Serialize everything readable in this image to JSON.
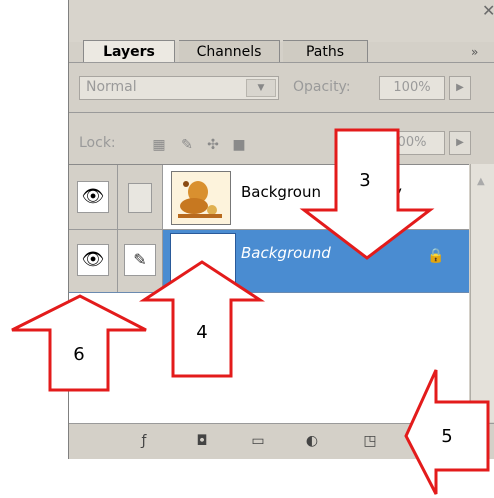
{
  "panel": {
    "close_glyph": "✕",
    "tabs": [
      {
        "label": "Layers",
        "active": true
      },
      {
        "label": "Channels",
        "active": false
      },
      {
        "label": "Paths",
        "active": false
      }
    ],
    "menu_glyph": "»",
    "blend_mode": "Normal",
    "opacity_label": "Opacity:",
    "opacity_value": "100%",
    "lock_label": "Lock:",
    "fill_value": "00%",
    "layers": [
      {
        "name": "Backgroun",
        "name_tail": "y",
        "selected": false,
        "visible": true,
        "locked": false
      },
      {
        "name": "Background",
        "selected": true,
        "visible": true,
        "locked": true
      }
    ],
    "bottom_icons": [
      "layer-style-icon",
      "mask-icon",
      "folder-icon",
      "adjustment-icon",
      "new-layer-icon"
    ]
  },
  "annotations": {
    "labels": [
      "3",
      "4",
      "5",
      "6"
    ],
    "arrow_color": "#e31b1b"
  },
  "colors": {
    "panel_bg": "#d4d0c8",
    "selected_row": "#4a8cd1"
  }
}
